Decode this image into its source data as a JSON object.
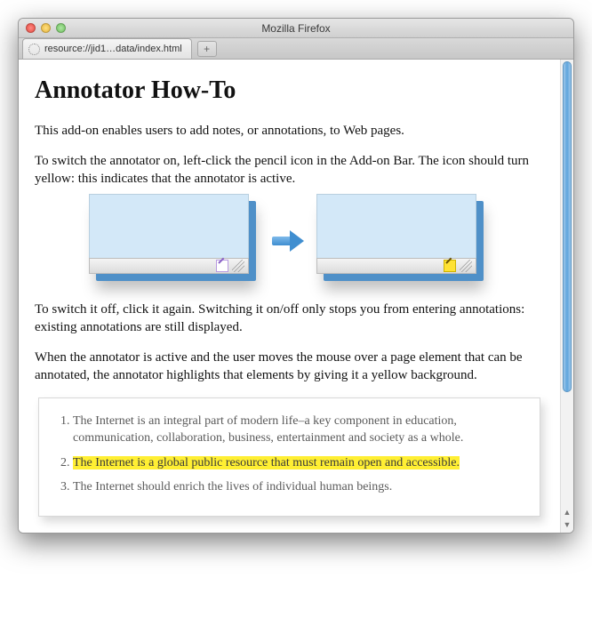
{
  "window": {
    "title": "Mozilla Firefox"
  },
  "tab": {
    "label": "resource://jid1…data/index.html"
  },
  "page": {
    "heading": "Annotator How-To",
    "p1": "This add-on enables users to add notes, or annotations, to Web pages.",
    "p2": "To switch the annotator on, left-click the pencil icon in the Add-on Bar. The icon should turn yellow: this indicates that the annotator is active.",
    "p3": "To switch it off, click it again. Switching it on/off only stops you from entering annotations: existing annotations are still displayed.",
    "p4": "When the annotator is active and the user moves the mouse over a page element that can be annotated, the annotator highlights that elements by giving it a yellow background."
  },
  "manifesto": {
    "item1": "The Internet is an integral part of modern life–a key component in education, communication, collaboration, business, entertainment and society as a whole.",
    "item2": "The Internet is a global public resource that must remain open and accessible.",
    "item3": "The Internet should enrich the lives of individual human beings."
  }
}
